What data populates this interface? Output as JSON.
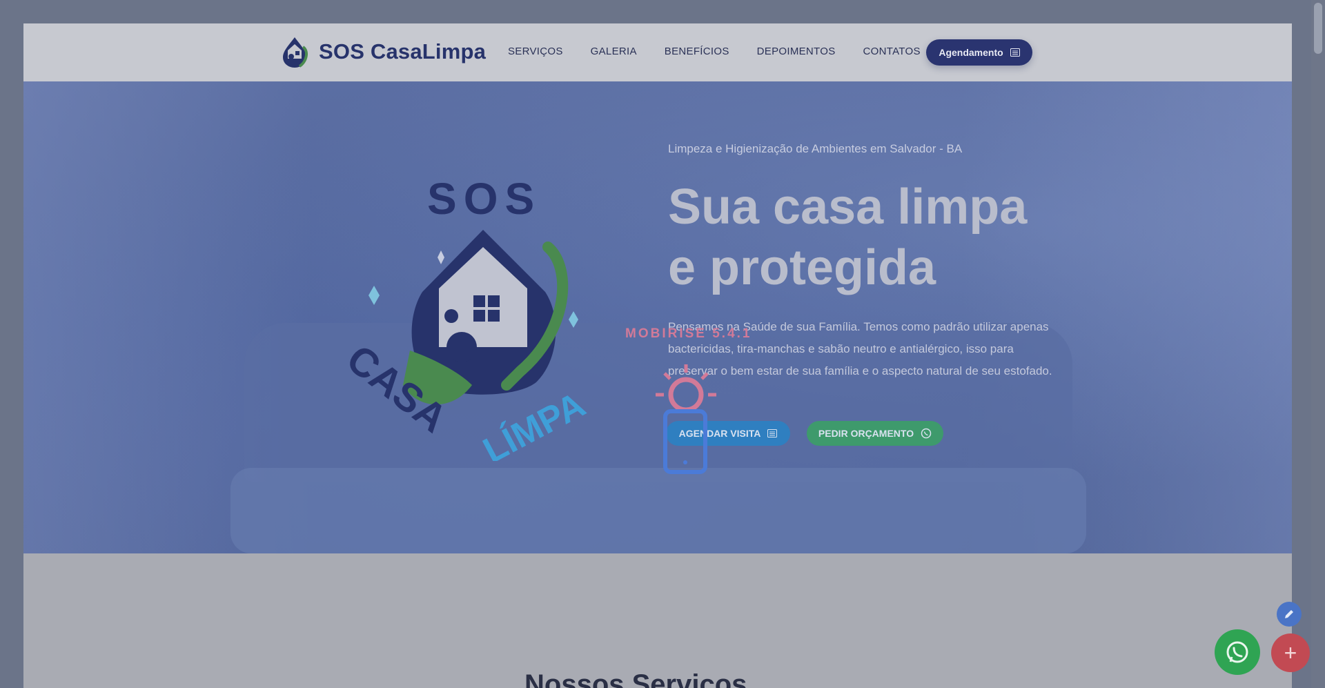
{
  "navbar": {
    "brand_name": "SOS CasaLimpa",
    "links": [
      "SERVIÇOS",
      "GALERIA",
      "BENEFÍCIOS",
      "DEPOIMENTOS",
      "CONTATOS"
    ],
    "cta_label": "Agendamento",
    "cta_icon": "calendar-icon"
  },
  "hero": {
    "subtitle": "Limpeza e Higienização de Ambientes em Salvador - BA",
    "title": "Sua casa limpa e protegida",
    "text": "Pensamos na Saúde de sua Família. Temos como padrão utilizar apenas bactericidas, tira-manchas e sabão neutro e antialérgico, isso para preservar o bem estar de sua família e o aspecto natural de seu estofado.",
    "logo": {
      "top_text": "SOS",
      "bottom_text_dark": "CASA",
      "bottom_text_light": "LÍMPA"
    },
    "buttons": {
      "visita_label": "AGENDAR VISITA",
      "visita_icon": "calendar-icon",
      "orcamento_label": "PEDIR ORÇAMENTO",
      "orcamento_icon": "whatsapp-icon"
    }
  },
  "overlay": {
    "mobirise_label": "MOBIRISE 5.4.1"
  },
  "next_section": {
    "heading_partial": "Nossos Serviços"
  },
  "floating_buttons": {
    "edit_icon": "pencil-icon",
    "whatsapp_icon": "whatsapp-icon",
    "add_label": "+"
  },
  "colors": {
    "brand_dark": "#27336b",
    "brand_green": "#4a8a4f",
    "brand_blue": "#3f9fd8",
    "overlay_tint": "#6b7489",
    "btn_visita": "#2f7fc0",
    "btn_orcamento": "#3e9a6c",
    "fab_whatsapp": "#2fa453",
    "fab_add": "#c24a53"
  }
}
